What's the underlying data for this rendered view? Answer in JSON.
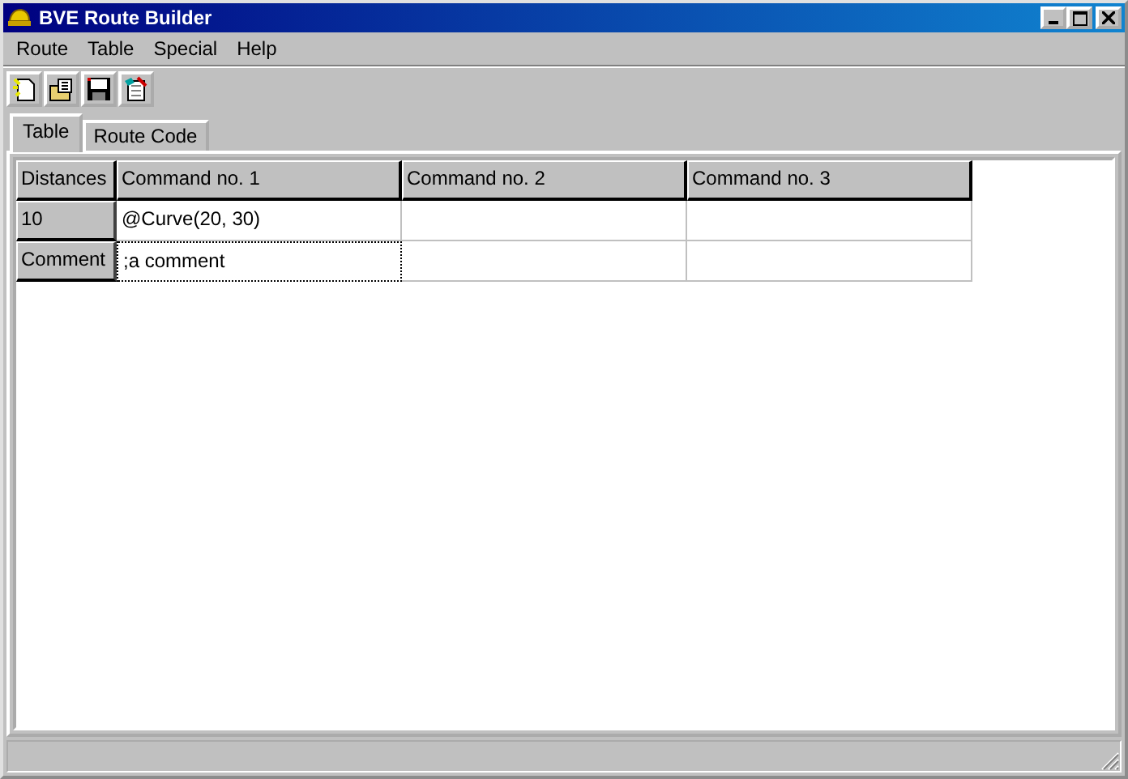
{
  "window": {
    "title": "BVE Route Builder"
  },
  "menu": [
    "Route",
    "Table",
    "Special",
    "Help"
  ],
  "toolbar": [
    {
      "kind": "new"
    },
    {
      "kind": "open"
    },
    {
      "kind": "save"
    },
    {
      "kind": "edit"
    }
  ],
  "tabs": [
    {
      "label": "Table",
      "selected": true
    },
    {
      "label": "Route Code",
      "selected": false
    }
  ],
  "table": {
    "corner": "Distances",
    "columns": [
      "Command no. 1",
      "Command no. 2",
      "Command no. 3"
    ],
    "rows": [
      {
        "header": "10",
        "cells": [
          {
            "text": "@Curve(20, 30)",
            "focused": false
          },
          {
            "focused": false
          },
          {
            "focused": false
          }
        ]
      },
      {
        "header": "Comment",
        "cells": [
          {
            "text": ";a comment",
            "focused": true
          },
          {
            "focused": false
          },
          {
            "focused": false
          }
        ]
      }
    ]
  }
}
